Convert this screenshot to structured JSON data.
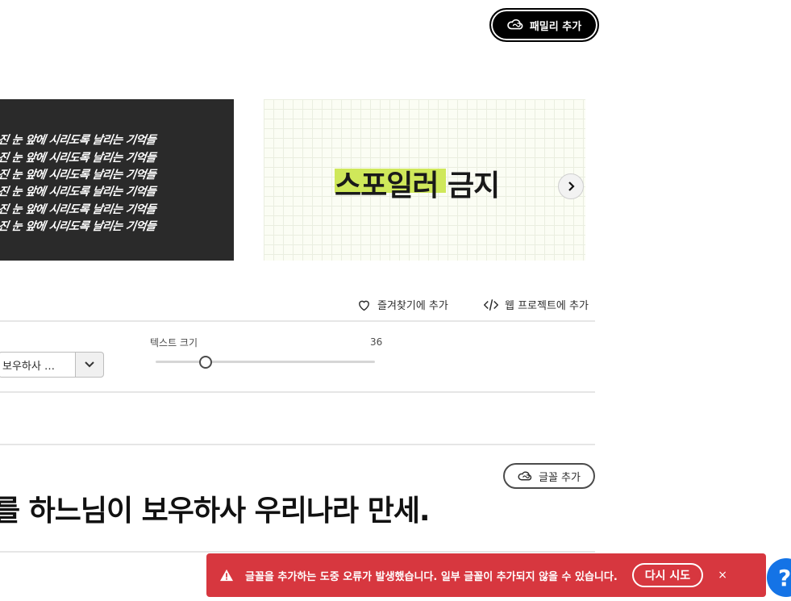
{
  "header": {
    "add_family_label": "패밀리 추가",
    "cc_icon": "creative-cloud-icon"
  },
  "specimens": {
    "dark_lines": [
      "진 눈 앞에 시리도록 날리는 기억들",
      "진 눈 앞에 시리도록 날리는 기억들",
      "진 눈 앞에 시리도록 날리는 기억들",
      "진 눈 앞에 시리도록 날리는 기억들",
      "진 눈 앞에 시리도록 날리는 기억들",
      "진 눈 앞에 시리도록 날리는 기억들"
    ],
    "light_headline": "스포일러 금지",
    "next_icon": "chevron-right-icon"
  },
  "actions": {
    "favorite_label": "즐겨찾기에 추가",
    "favorite_icon": "heart-icon",
    "web_project_label": "웹 프로젝트에 추가",
    "web_project_icon": "code-icon"
  },
  "controls": {
    "sample_select_value": "보우하사 …",
    "text_size_label": "텍스트 크기",
    "text_size_value": "36"
  },
  "font_card": {
    "add_font_label": "글꼴 추가",
    "sample_text": "를 하느님이 보우하사 우리나라 만세."
  },
  "toast": {
    "message": "글꼴을 추가하는 도중 오류가 발생했습니다. 일부 글꼴이 추가되지 않을 수 있습니다.",
    "retry_label": "다시 시도",
    "close_label": "×",
    "warning_icon": "warning-icon"
  },
  "help": {
    "label": "?"
  },
  "colors": {
    "error": "#d7373f",
    "help": "#1473e6",
    "highlight": "#cfe85a"
  }
}
